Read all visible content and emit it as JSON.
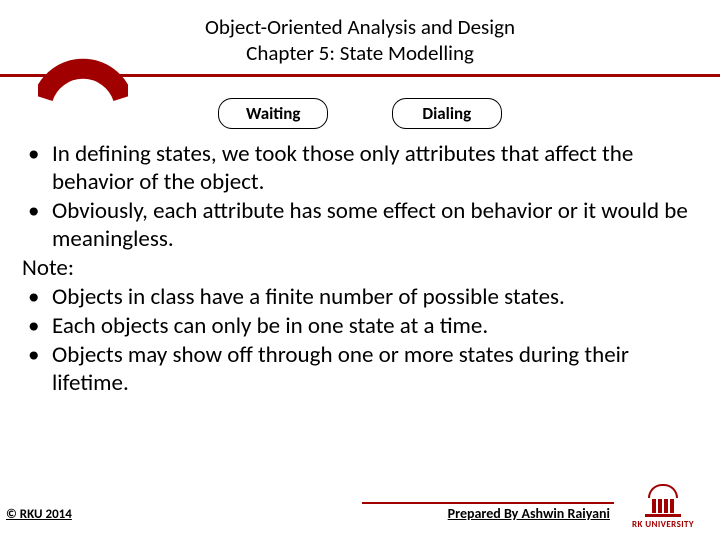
{
  "header": {
    "line1": "Object-Oriented Analysis and Design",
    "line2": "Chapter 5: State Modelling"
  },
  "states": {
    "left": "Waiting",
    "right": "Dialing"
  },
  "body": {
    "bullets_top": [
      "In defining states, we took those only attributes that affect the behavior of the object.",
      "Obviously, each attribute has some effect on behavior or it would be meaningless."
    ],
    "note_label": "Note:",
    "bullets_note": [
      "Objects in class have a finite number of possible states.",
      "Each objects can only be in one state at a time.",
      "Objects may show off through one or more states during their lifetime."
    ]
  },
  "footer": {
    "copyright": "© RKU 2014",
    "prepared": "Prepared By Ashwin Raiyani",
    "university": "RK UNIVERSITY"
  },
  "colors": {
    "accent": "#a00000"
  }
}
